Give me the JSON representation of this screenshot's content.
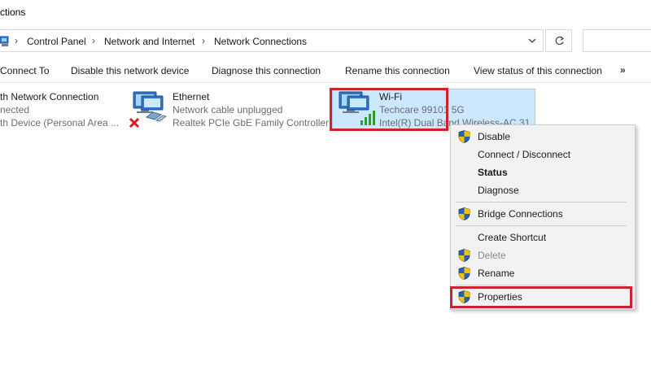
{
  "window": {
    "title_fragment": "ctions"
  },
  "breadcrumb": {
    "items": [
      "Control Panel",
      "Network and Internet",
      "Network Connections"
    ]
  },
  "toolbar": {
    "commands": [
      "Connect To",
      "Disable this network device",
      "Diagnose this connection",
      "Rename this connection",
      "View status of this connection"
    ],
    "more": "»"
  },
  "connections": [
    {
      "name": "th Network Connection",
      "status": "nected",
      "device": "th Device (Personal Area ..."
    },
    {
      "name": "Ethernet",
      "status": "Network cable unplugged",
      "device": "Realtek PCIe GbE Family Controller"
    },
    {
      "name": "Wi-Fi",
      "status": "Techcare 99101 5G",
      "device": "Intel(R) Dual Band Wireless-AC 31"
    }
  ],
  "context_menu": {
    "items": [
      {
        "label": "Disable",
        "shield": true
      },
      {
        "label": "Connect / Disconnect",
        "shield": false
      },
      {
        "label": "Status",
        "shield": false,
        "bold": true
      },
      {
        "label": "Diagnose",
        "shield": false
      },
      {
        "label": "Bridge Connections",
        "shield": true
      },
      {
        "label": "Create Shortcut",
        "shield": false
      },
      {
        "label": "Delete",
        "shield": true,
        "disabled": true
      },
      {
        "label": "Rename",
        "shield": true
      },
      {
        "label": "Properties",
        "shield": true
      }
    ]
  },
  "colors": {
    "selection": "#cce8ff",
    "highlight_border": "#d0222e",
    "menu_background": "#f2f2f2"
  }
}
